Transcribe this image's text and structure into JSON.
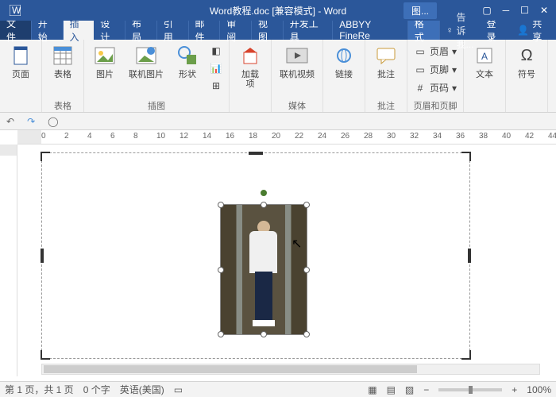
{
  "title": {
    "docname": "Word教程.doc [兼容模式] - Word",
    "contextual_tab": "图...",
    "window_controls": [
      "user-icon",
      "minimize",
      "maximize",
      "close"
    ]
  },
  "tabs": {
    "file": "文件",
    "items": [
      "开始",
      "插入",
      "设计",
      "布局",
      "引用",
      "邮件",
      "审阅",
      "视图",
      "开发工具",
      "ABBYY FineRe"
    ],
    "active_index": 1,
    "context_tab": "格式",
    "tell_me": "告诉我...",
    "login": "登录",
    "share": "共享"
  },
  "ribbon": {
    "pages": {
      "label": "页面",
      "btn": "页面"
    },
    "tables": {
      "label": "表格",
      "btn": "表格"
    },
    "illus": {
      "label": "插图",
      "pic": "图片",
      "online_pic": "联机图片",
      "shapes": "形状"
    },
    "addins": {
      "label": "",
      "btn": "加载\n项"
    },
    "media": {
      "label": "媒体",
      "btn": "联机视频"
    },
    "links": {
      "label": "",
      "btn": "链接"
    },
    "comments": {
      "label": "批注",
      "btn": "批注"
    },
    "headerfooter": {
      "label": "页眉和页脚",
      "header": "页眉",
      "footer": "页脚",
      "pagenum": "页码"
    },
    "text": {
      "label": "文本",
      "btn": "文本"
    },
    "symbols": {
      "label": "符号",
      "btn": "符号"
    }
  },
  "ruler_marks": [
    0,
    2,
    4,
    6,
    8,
    10,
    12,
    14,
    16,
    18,
    20,
    22,
    24,
    26,
    28,
    30,
    32,
    34,
    36,
    38,
    40,
    42,
    44
  ],
  "status": {
    "page": "第 1 页，共 1 页",
    "words": "0 个字",
    "lang": "英语(美国)",
    "zoom": "100%"
  }
}
